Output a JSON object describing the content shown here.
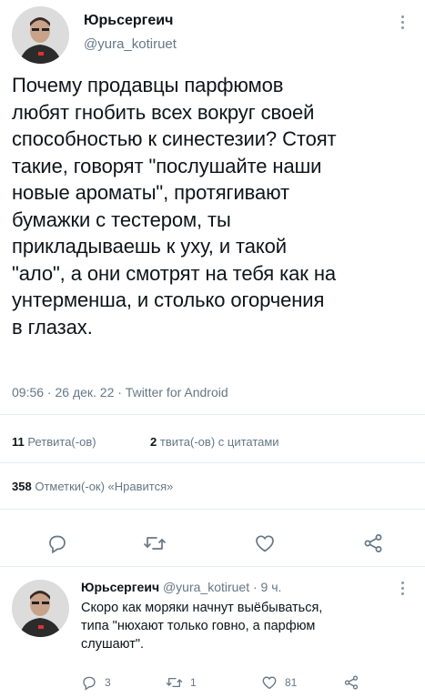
{
  "main_tweet": {
    "author_name": "Юрьсергеич",
    "handle": "@yura_kotiruet",
    "text_lines": [
      "Почему продавцы парфюмов",
      "любят гнобить всех вокруг своей",
      "способностью к синестезии? Стоят",
      "такие, говорят \"послушайте наши",
      "новые ароматы\", протягивают",
      "бумажки с тестером, ты",
      "прикладываешь к уху, и такой",
      "\"ало\", а они смотрят на тебя как на",
      "унтерменша, и столько огорчения",
      "в глазах."
    ],
    "meta": "09:56 · 26 дек. 22 · Twitter for Android",
    "retweets_count": "11",
    "retweets_label": "Ретвита(-ов)",
    "quotes_count": "2",
    "quotes_label": "твита(-ов) с цитатами",
    "likes_count": "358",
    "likes_label": "Отметки(-ок) «Нравится»",
    "actions": [
      "reply-icon",
      "retweet-icon",
      "like-icon",
      "share-icon"
    ]
  },
  "reply_tweet": {
    "author_name": "Юрьсергеич",
    "handle_time": "@yura_kotiruet · 9 ч.",
    "text_lines": [
      "Скоро как моряки начнут выёбываться,",
      "типа \"нюхают только говно, а парфюм",
      "слушают\"."
    ],
    "reply_count": "3",
    "retweet_count": "1",
    "like_count": "81"
  },
  "colors": {
    "text": "#0f1419",
    "muted": "#657786",
    "divider": "#e6ecf0",
    "icon": "#657786"
  }
}
